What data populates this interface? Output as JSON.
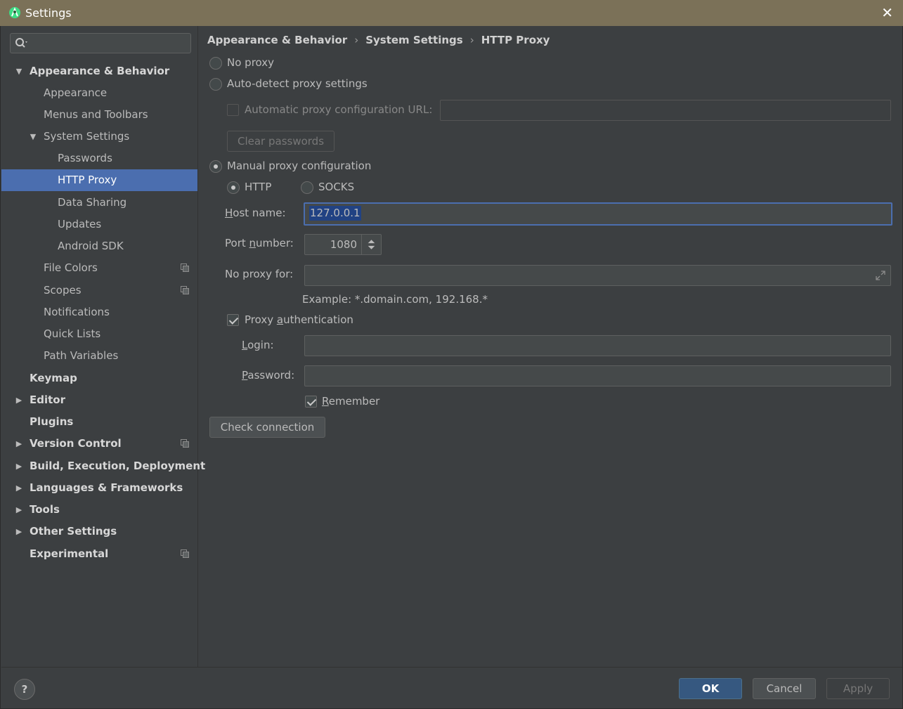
{
  "window": {
    "title": "Settings",
    "close_glyph": "✕"
  },
  "search": {
    "placeholder": "",
    "value": ""
  },
  "tree": {
    "items": [
      {
        "label": "Appearance & Behavior",
        "expanded": true
      },
      {
        "label": "Appearance"
      },
      {
        "label": "Menus and Toolbars"
      },
      {
        "label": "System Settings",
        "expanded": true
      },
      {
        "label": "Passwords"
      },
      {
        "label": "HTTP Proxy",
        "selected": true
      },
      {
        "label": "Data Sharing"
      },
      {
        "label": "Updates"
      },
      {
        "label": "Android SDK"
      },
      {
        "label": "File Colors",
        "project_icon": true
      },
      {
        "label": "Scopes",
        "project_icon": true
      },
      {
        "label": "Notifications"
      },
      {
        "label": "Quick Lists"
      },
      {
        "label": "Path Variables"
      },
      {
        "label": "Keymap"
      },
      {
        "label": "Editor",
        "expanded": false
      },
      {
        "label": "Plugins"
      },
      {
        "label": "Version Control",
        "expanded": false,
        "project_icon": true
      },
      {
        "label": "Build, Execution, Deployment",
        "expanded": false
      },
      {
        "label": "Languages & Frameworks",
        "expanded": false
      },
      {
        "label": "Tools",
        "expanded": false
      },
      {
        "label": "Other Settings",
        "expanded": false
      },
      {
        "label": "Experimental",
        "project_icon": true
      }
    ]
  },
  "breadcrumb": [
    "Appearance & Behavior",
    "System Settings",
    "HTTP Proxy"
  ],
  "breadcrumb_sep": "›",
  "proxy": {
    "no_proxy_label": "No proxy",
    "auto_detect_label": "Auto-detect proxy settings",
    "auto_config_url_label": "Automatic proxy configuration URL:",
    "auto_config_url_value": "",
    "clear_passwords_label": "Clear passwords",
    "manual_label": "Manual proxy configuration",
    "selected_mode": "manual",
    "http_label": "HTTP",
    "socks_label": "SOCKS",
    "selected_type": "HTTP",
    "host_label_u": "H",
    "host_label_rest": "ost name:",
    "host_value": "127.0.0.1",
    "port_label_pre": "Port ",
    "port_label_u": "n",
    "port_label_rest": "umber:",
    "port_value": "1080",
    "no_proxy_for_label": "No proxy for:",
    "no_proxy_for_value": "",
    "example_text": "Example: *.domain.com, 192.168.*",
    "proxy_auth_pre": "Proxy ",
    "proxy_auth_u": "a",
    "proxy_auth_rest": "uthentication",
    "proxy_auth_checked": true,
    "login_u": "L",
    "login_rest": "ogin:",
    "login_value": "",
    "password_u": "P",
    "password_rest": "assword:",
    "password_value": "",
    "remember_u": "R",
    "remember_rest": "emember",
    "remember_checked": true,
    "check_connection_label": "Check connection"
  },
  "footer": {
    "help_label": "?",
    "ok_label": "OK",
    "cancel_label": "Cancel",
    "apply_label": "Apply"
  },
  "colors": {
    "selection": "#4b6eaf",
    "background": "#3c3f41",
    "title_bar": "#7b7158",
    "ok_button": "#365880"
  },
  "icons": {
    "app": "android-studio-icon",
    "search": "search-icon",
    "project": "project-level-icon",
    "expand": "expand-icon",
    "help": "help-icon"
  }
}
